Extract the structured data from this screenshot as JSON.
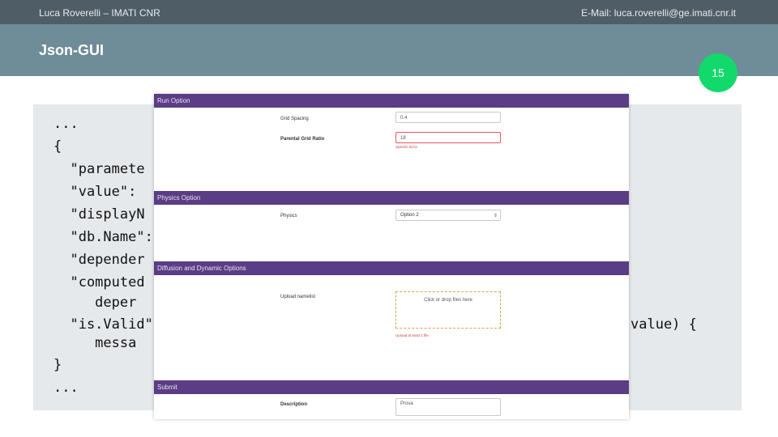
{
  "header": {
    "author": "Luca Roverelli – IMATI CNR",
    "email": "E-Mail: luca.roverelli@ge.imati.cnr.it",
    "title": "Json-GUI",
    "page_number": "15"
  },
  "code_visible": {
    "line1": "...",
    "line2": "{",
    "line3": "  \"paramete",
    "line4": "  \"value\":",
    "line5": "  \"displayN",
    "line6": "  \"db.Name\":",
    "line7": "  \"depender",
    "line8": "  \"computed",
    "line9": "     deper",
    "line10_left": "  \"is.Valid\"",
    "line10_right": "value) {",
    "line11": "     messa",
    "line12": "}",
    "line13": "..."
  },
  "form": {
    "sections": [
      {
        "header": "Run Option"
      },
      {
        "header": "Physics Option"
      },
      {
        "header": "Diffusion and Dynamic Options"
      },
      {
        "header": "Submit"
      }
    ],
    "run_option": {
      "grid_spacing_label": "Grid Spacing",
      "grid_spacing_value": "0.4",
      "parental_ratio_label": "Parental Grid Ratio",
      "parental_ratio_value": "18",
      "parental_ratio_error": "Specific Error"
    },
    "physics_option": {
      "physics_label": "Physics",
      "physics_selected": "Option 2"
    },
    "diffusion": {
      "upload_label": "Upload namelist",
      "dropzone_text": "Click or drop files here",
      "upload_hint": "Upload at least 1 file"
    },
    "submit": {
      "description_label": "Description",
      "description_value": "Prova"
    }
  },
  "colors": {
    "topbar": "#4f5d66",
    "titlebar": "#6f8c99",
    "page_badge": "#12d96b",
    "section_header": "#5a3d84",
    "code_background": "#e6e9ec"
  }
}
